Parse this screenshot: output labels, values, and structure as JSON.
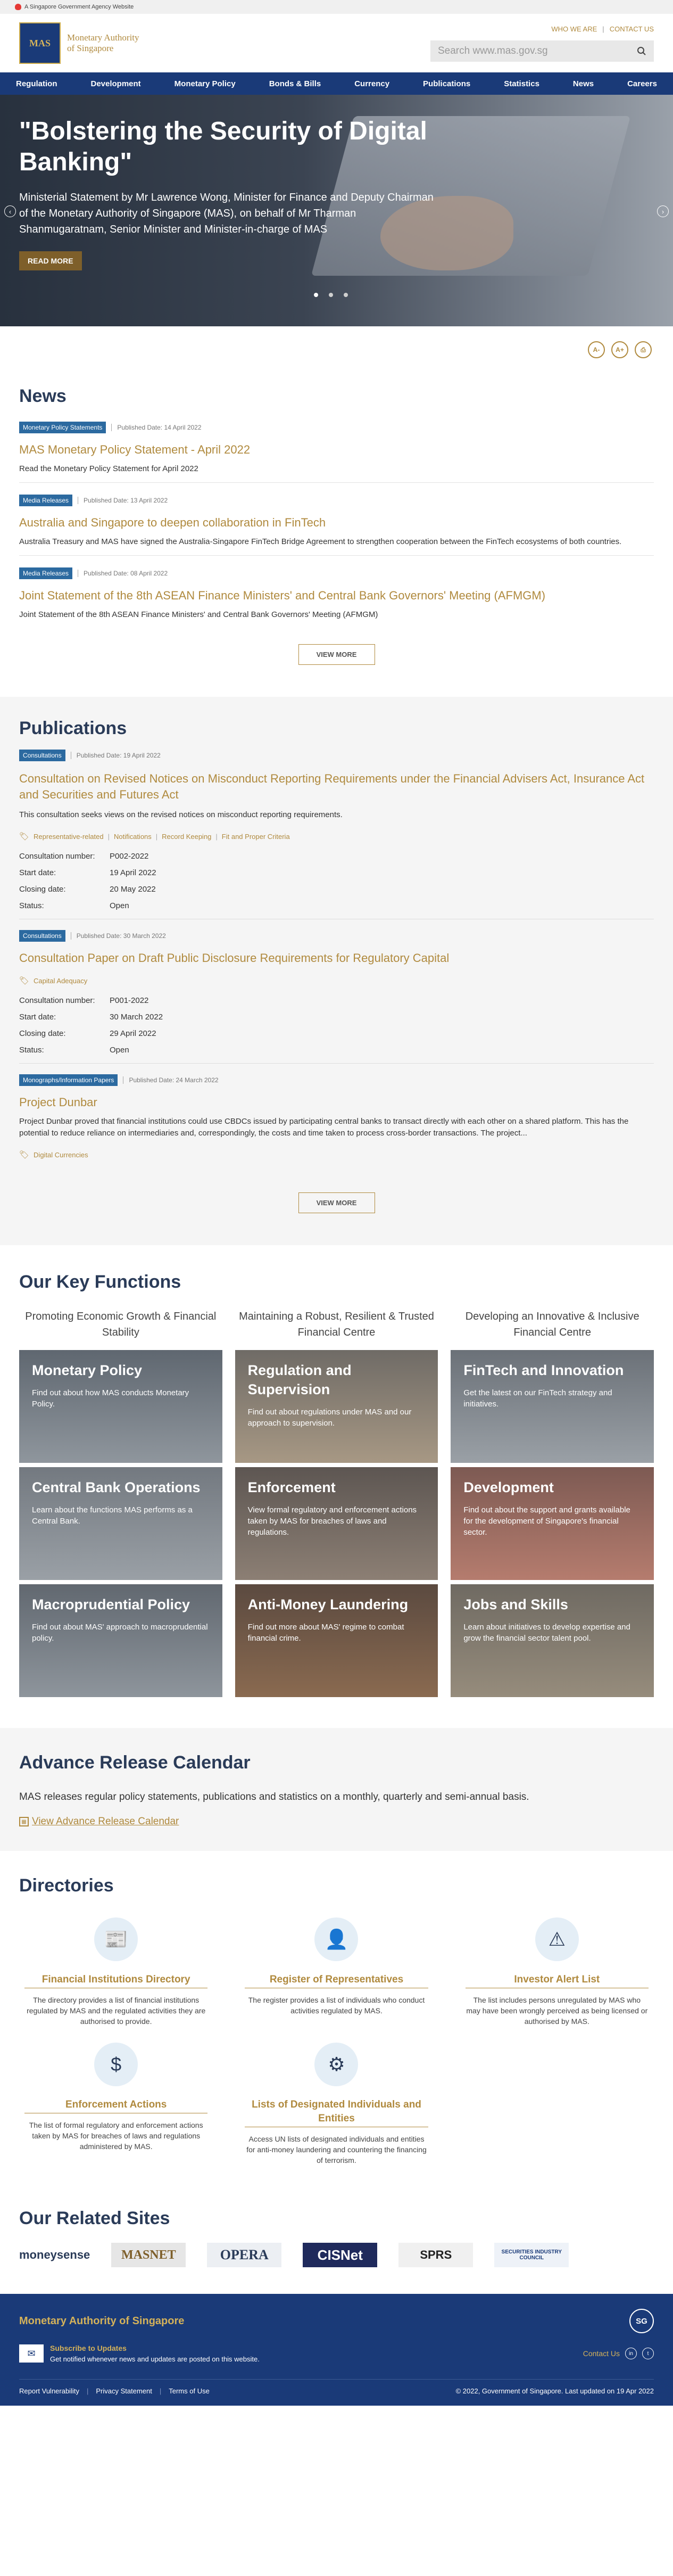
{
  "gov_bar": {
    "text": "A Singapore Government Agency Website"
  },
  "header": {
    "logo_mark": "MAS",
    "logo_text": "Monetary Authority of Singapore",
    "top_links": [
      "WHO WE ARE",
      "CONTACT US"
    ],
    "search_placeholder": "Search www.mas.gov.sg"
  },
  "nav": [
    "Regulation",
    "Development",
    "Monetary Policy",
    "Bonds & Bills",
    "Currency",
    "Publications",
    "Statistics",
    "News",
    "Careers"
  ],
  "hero": {
    "title": "\"Bolstering the Security of Digital Banking\"",
    "subtitle": "Ministerial Statement by Mr Lawrence Wong, Minister for Finance and Deputy Chairman of the Monetary Authority of Singapore (MAS), on behalf of Mr Tharman Shanmugaratnam, Senior Minister and Minister-in-charge of MAS",
    "button": "READ MORE",
    "prev": "‹",
    "next": "›"
  },
  "tools": {
    "decrease": "A-",
    "increase": "A+",
    "print": "⎙"
  },
  "news": {
    "heading": "News",
    "items": [
      {
        "badge": "Monetary Policy Statements",
        "date": "Published Date: 14 April 2022",
        "title": "MAS Monetary Policy Statement - April 2022",
        "desc": "Read the Monetary Policy Statement for April 2022"
      },
      {
        "badge": "Media Releases",
        "date": "Published Date: 13 April 2022",
        "title": "Australia and Singapore to deepen collaboration in FinTech",
        "desc": "Australia Treasury and MAS have signed the Australia-Singapore FinTech Bridge Agreement to strengthen cooperation between the FinTech ecosystems of both countries."
      },
      {
        "badge": "Media Releases",
        "date": "Published Date: 08 April 2022",
        "title": "Joint Statement of the 8th ASEAN Finance Ministers' and Central Bank Governors' Meeting (AFMGM)",
        "desc": "Joint Statement of the 8th ASEAN Finance Ministers' and Central Bank Governors' Meeting (AFMGM)"
      }
    ],
    "view_more": "VIEW MORE"
  },
  "publications": {
    "heading": "Publications",
    "items": [
      {
        "badge": "Consultations",
        "date": "Published Date: 19 April 2022",
        "title": "Consultation on Revised Notices on Misconduct Reporting Requirements under the Financial Advisers Act, Insurance Act and Securities and Futures Act",
        "desc": "This consultation seeks views on the revised notices on misconduct reporting requirements.",
        "tags": [
          "Representative-related",
          "Notifications",
          "Record Keeping",
          "Fit and Proper Criteria"
        ],
        "fields": [
          [
            "Consultation number:",
            "P002-2022"
          ],
          [
            "Start date:",
            "19 April 2022"
          ],
          [
            "Closing date:",
            "20 May 2022"
          ],
          [
            "Status:",
            "Open"
          ]
        ]
      },
      {
        "badge": "Consultations",
        "date": "Published Date: 30 March 2022",
        "title": "Consultation Paper on Draft Public Disclosure Requirements for Regulatory Capital",
        "desc": "",
        "tags": [
          "Capital Adequacy"
        ],
        "fields": [
          [
            "Consultation number:",
            "P001-2022"
          ],
          [
            "Start date:",
            "30 March 2022"
          ],
          [
            "Closing date:",
            "29 April 2022"
          ],
          [
            "Status:",
            "Open"
          ]
        ]
      },
      {
        "badge": "Monographs/Information Papers",
        "date": "Published Date: 24 March 2022",
        "title": "Project Dunbar",
        "desc": "Project Dunbar proved that financial institutions could use CBDCs issued by participating central banks to transact directly with each other on a shared platform. This has the potential to reduce reliance on intermediaries and, correspondingly, the costs and time taken to process cross-border transactions. The project...",
        "tags": [
          "Digital Currencies"
        ],
        "fields": []
      }
    ],
    "view_more": "VIEW MORE"
  },
  "key_functions": {
    "heading": "Our Key Functions",
    "columns": [
      {
        "head": "Promoting Economic Growth & Financial Stability",
        "tiles": [
          {
            "title": "Monetary Policy",
            "desc": "Find out about how MAS conducts Monetary Policy."
          },
          {
            "title": "Central Bank Operations",
            "desc": "Learn about the functions MAS performs as a Central Bank."
          },
          {
            "title": "Macroprudential Policy",
            "desc": "Find out about MAS' approach to macroprudential policy."
          }
        ]
      },
      {
        "head": "Maintaining a Robust, Resilient & Trusted Financial Centre",
        "tiles": [
          {
            "title": "Regulation and Supervision",
            "desc": "Find out about regulations under MAS and our approach to supervision."
          },
          {
            "title": "Enforcement",
            "desc": "View formal regulatory and enforcement actions taken by MAS for breaches of laws and regulations."
          },
          {
            "title": "Anti-Money Laundering",
            "desc": "Find out more about MAS' regime to combat financial crime."
          }
        ]
      },
      {
        "head": "Developing an Innovative & Inclusive Financial Centre",
        "tiles": [
          {
            "title": "FinTech and Innovation",
            "desc": "Get the latest on our FinTech strategy and initiatives."
          },
          {
            "title": "Development",
            "desc": "Find out about the support and grants available for the development of Singapore's financial sector."
          },
          {
            "title": "Jobs and Skills",
            "desc": "Learn about initiatives to develop expertise and grow the financial sector talent pool."
          }
        ]
      }
    ]
  },
  "arc": {
    "heading": "Advance Release Calendar",
    "desc": "MAS releases regular policy statements, publications and statistics on a monthly, quarterly and semi-annual basis.",
    "link": "View Advance Release Calendar"
  },
  "directories": {
    "heading": "Directories",
    "items": [
      {
        "icon": "📰",
        "title": "Financial Institutions Directory",
        "desc": "The directory provides a list of financial institutions regulated by MAS and the regulated activities they are authorised to provide."
      },
      {
        "icon": "👤",
        "title": "Register of Representatives",
        "desc": "The register provides a list of individuals who conduct activities regulated by MAS."
      },
      {
        "icon": "⚠",
        "title": "Investor Alert List",
        "desc": "The list includes persons unregulated by MAS who may have been wrongly perceived as being licensed or authorised by MAS."
      },
      {
        "icon": "$",
        "title": "Enforcement Actions",
        "desc": "The list of formal regulatory and enforcement actions taken by MAS for breaches of laws and regulations administered by MAS."
      },
      {
        "icon": "⚙",
        "title": "Lists of Designated Individuals and Entities",
        "desc": "Access UN lists of designated individuals and entities for anti-money laundering and countering the financing of terrorism."
      }
    ]
  },
  "related": {
    "heading": "Our Related Sites",
    "logos": [
      "moneysense",
      "MASNET",
      "OPERA",
      "CISNet",
      "SPRS",
      "SECURITIES INDUSTRY COUNCIL"
    ]
  },
  "footer": {
    "title": "Monetary Authority of Singapore",
    "sg_mark": "SG",
    "subscribe_title": "Subscribe to Updates",
    "subscribe_desc": "Get notified whenever news and updates are posted on this website.",
    "contact": "Contact Us",
    "links": [
      "Report Vulnerability",
      "Privacy Statement",
      "Terms of Use"
    ],
    "copyright": "© 2022, Government of Singapore. Last updated on 19 Apr 2022"
  }
}
